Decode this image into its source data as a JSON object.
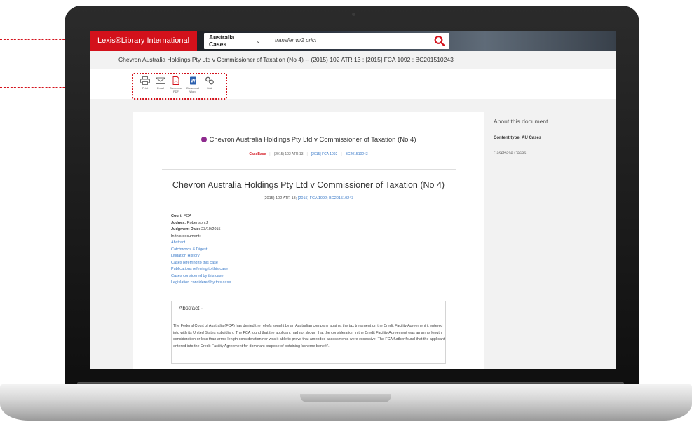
{
  "app": {
    "brand_label": "Lexis®Library International"
  },
  "search": {
    "category_label": "Australia Cases",
    "query": "transfer w/2 pric!"
  },
  "breadcrumb": "Chevron Australia Holdings Pty Ltd v Commissioner of Taxation (No 4) -- (2015) 102 ATR 13 ; [2015] FCA 1092 ; BC201510243",
  "toolbar": {
    "items": [
      {
        "label": "Print",
        "icon": "print-icon"
      },
      {
        "label": "Email",
        "icon": "email-icon"
      },
      {
        "label": "Download PDF",
        "icon": "pdf-icon"
      },
      {
        "label": "Download Word",
        "icon": "word-icon"
      },
      {
        "label": "Link",
        "icon": "link-icon"
      }
    ]
  },
  "document": {
    "title_small": "Chevron Australia Holdings Pty Ltd v Commissioner of Taxation (No 4)",
    "citations": {
      "casebase": "CaseBase",
      "atr": "(2015) 102 ATR 13",
      "fca": "[2015] FCA 1092",
      "bc": "BC201510243"
    },
    "title_large": "Chevron Australia Holdings Pty Ltd v Commissioner of Taxation (No 4)",
    "citation_line_prefix": "(2015) 102 ATR 13;",
    "citation_line_links": "[2015] FCA 1092; BC201510243",
    "meta": {
      "court_label": "Court:",
      "court": "FCA",
      "judges_label": "Judges:",
      "judges": "Robertson J",
      "date_label": "Judgment Date:",
      "date": "23/10/2015",
      "in_doc": "In this document:"
    },
    "toc": [
      "Abstract",
      "Catchwords & Digest",
      "Litigation History",
      "Cases referring to this case",
      "Publications referring to this case",
      "Cases considered by this case",
      "Legislation considered by this case"
    ],
    "abstract_heading": "Abstract -",
    "abstract_text": "The Federal Court of Australia (FCA) has denied the reliefs sought by an Australian company against the tax treatment on the Credit Facility Agreement it entered into with its United States subsidiary. The FCA found that the applicant had not shown that the consideration in the Credit Facility Agreement was an arm's length consideration or less than arm's length consideration nor was it able to prove that amended assessments were excessive. The FCA further found that the applicant entered into the Credit Facility Agreement for dominant purpose of obtaining 'scheme benefit'."
  },
  "side_panel": {
    "title": "About this document",
    "content_type": "Content type: AU Cases",
    "source": "CaseBase Cases"
  },
  "colors": {
    "brand_red": "#d3111b",
    "link_blue": "#3d7cc9",
    "verified_purple": "#8e2a8e"
  }
}
